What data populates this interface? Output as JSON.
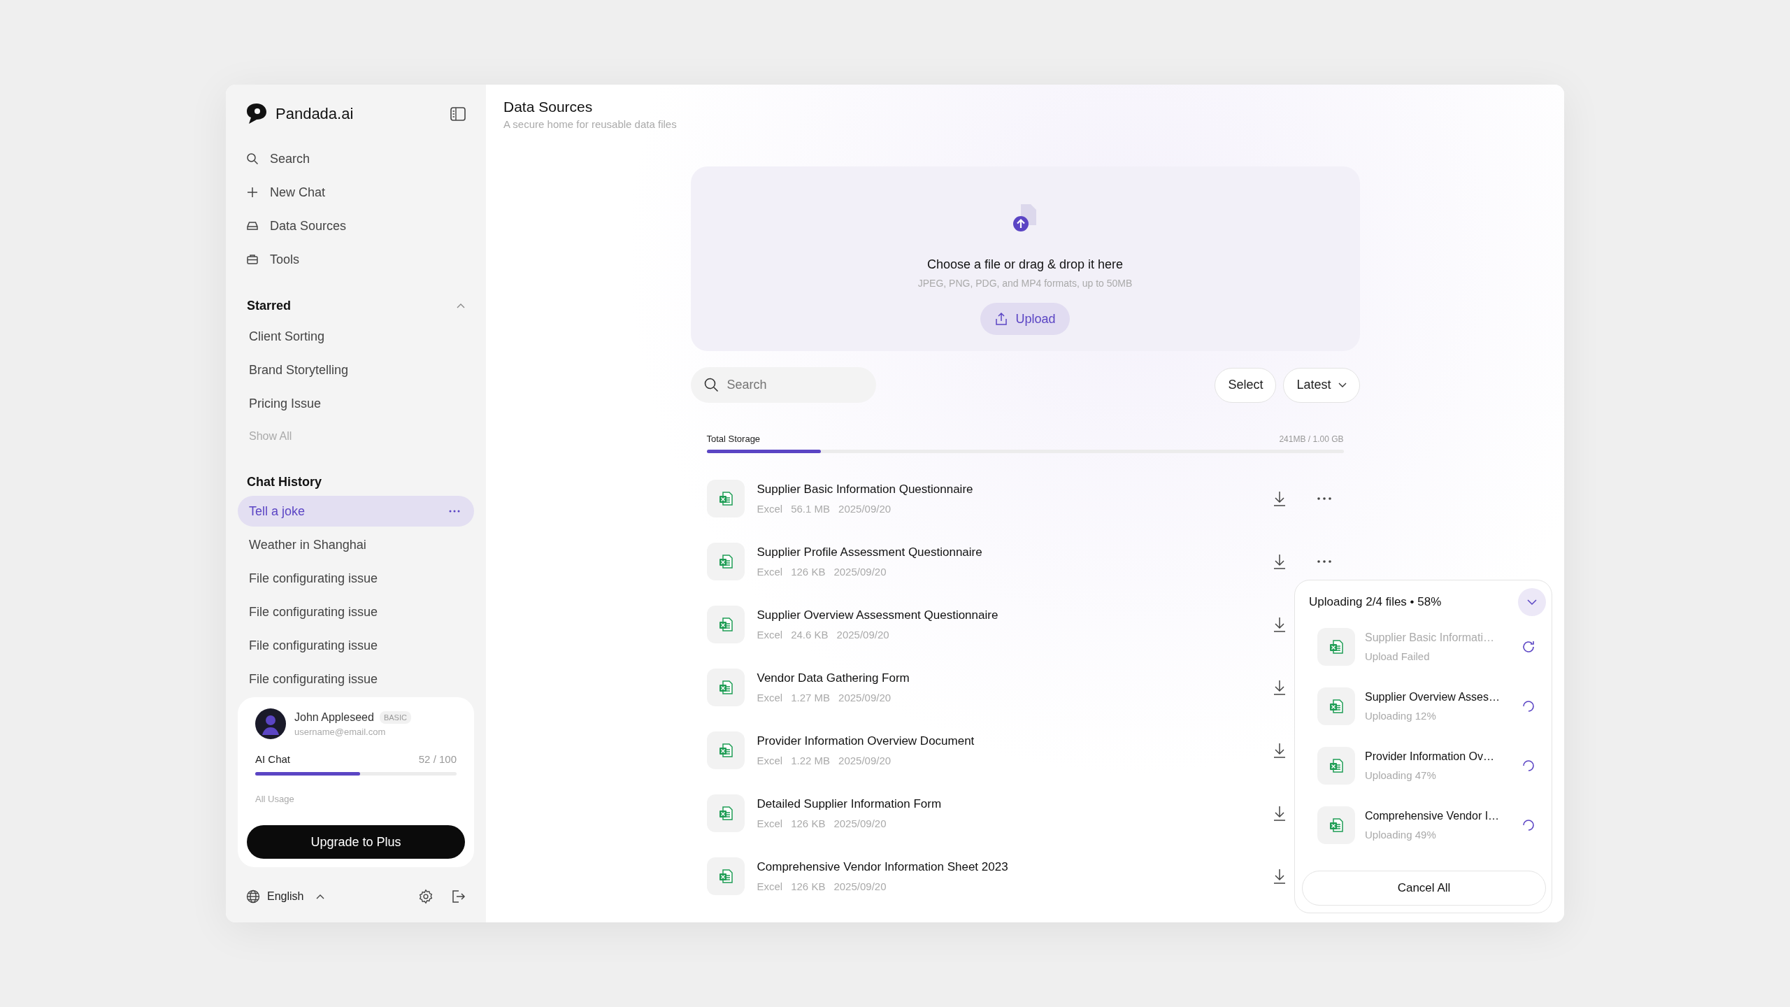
{
  "brand": {
    "name": "Pandada.ai"
  },
  "nav": [
    {
      "label": "Search",
      "kind": "search"
    },
    {
      "label": "New Chat",
      "kind": "plus"
    },
    {
      "label": "Data Sources",
      "kind": "drive"
    },
    {
      "label": "Tools",
      "kind": "toolbox"
    }
  ],
  "starred": {
    "title": "Starred",
    "expanded": true,
    "items": [
      "Client Sorting",
      "Brand Storytelling",
      "Pricing Issue"
    ],
    "show_all": "Show All"
  },
  "chat_history": {
    "title": "Chat History",
    "items": [
      {
        "label": "Tell a joke",
        "selected": true
      },
      {
        "label": "Weather in Shanghai",
        "selected": false
      },
      {
        "label": "File configurating issue",
        "selected": false
      },
      {
        "label": "File configurating issue",
        "selected": false
      },
      {
        "label": "File configurating issue",
        "selected": false
      },
      {
        "label": "File configurating issue",
        "selected": false
      }
    ]
  },
  "profile": {
    "name": "John Appleseed",
    "plan": "BASIC",
    "email": "username@email.com",
    "usage_label": "AI Chat",
    "usage_reading": "52 / 100",
    "level": 0.52,
    "all_usage": "All Usage",
    "upgrade": "Upgrade to Plus"
  },
  "footer": {
    "language": "English"
  },
  "page": {
    "title": "Data Sources",
    "subtitle": "A secure home for reusable data files"
  },
  "dropzone": {
    "title": "Choose a file or drag & drop it here",
    "hint": "JPEG, PNG, PDG, and MP4 formats, up to 50MB",
    "button": "Upload"
  },
  "search": {
    "placeholder": "Search"
  },
  "toolbar": {
    "select": "Select",
    "sort": "Latest"
  },
  "storage": {
    "label": "Total Storage",
    "reading": "241MB / 1.00 GB",
    "level": 0.18
  },
  "files": [
    {
      "name": "Supplier Basic Information Questionnaire",
      "type": "Excel",
      "size": "56.1 MB",
      "date": "2025/09/20"
    },
    {
      "name": "Supplier Profile Assessment Questionnaire",
      "type": "Excel",
      "size": "126 KB",
      "date": "2025/09/20"
    },
    {
      "name": "Supplier Overview Assessment Questionnaire",
      "type": "Excel",
      "size": "24.6 KB",
      "date": "2025/09/20"
    },
    {
      "name": "Vendor Data Gathering Form",
      "type": "Excel",
      "size": "1.27 MB",
      "date": "2025/09/20"
    },
    {
      "name": "Provider Information Overview Document",
      "type": "Excel",
      "size": "1.22 MB",
      "date": "2025/09/20"
    },
    {
      "name": "Detailed Supplier Information Form",
      "type": "Excel",
      "size": "126 KB",
      "date": "2025/09/20"
    },
    {
      "name": "Comprehensive Vendor Information Sheet 2023",
      "type": "Excel",
      "size": "126 KB",
      "date": "2025/09/20"
    }
  ],
  "upload_panel": {
    "title": "Uploading 2/4 files • 58%",
    "expanded": true,
    "items": [
      {
        "name": "Supplier Basic Informati…",
        "status": "Upload Failed",
        "kind": "failed"
      },
      {
        "name": "Supplier Overview Asses…",
        "status": "Uploading 12%",
        "kind": "uploading"
      },
      {
        "name": "Provider Information Ov…",
        "status": "Uploading 47%",
        "kind": "uploading"
      },
      {
        "name": "Comprehensive Vendor I…",
        "status": "Uploading 49%",
        "kind": "uploading"
      }
    ],
    "cancel": "Cancel All"
  }
}
